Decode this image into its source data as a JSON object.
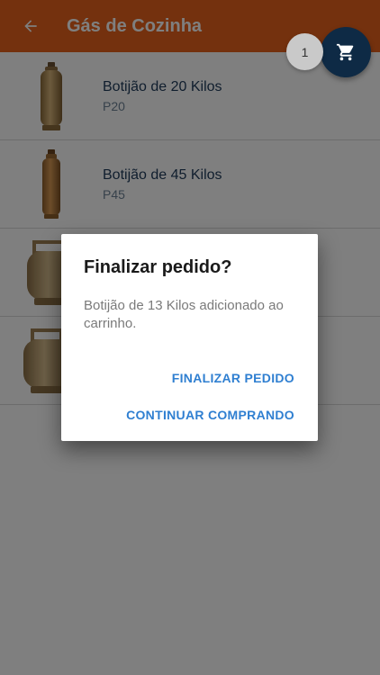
{
  "appbar": {
    "title": "Gás de Cozinha",
    "color": "#e8621c"
  },
  "cart": {
    "count": "1"
  },
  "products": [
    {
      "name": "Botijão de 20 Kilos",
      "code": "P20",
      "icon": "tall-gas-cylinder-icon"
    },
    {
      "name": "Botijão de 45 Kilos",
      "code": "P45",
      "icon": "large-gas-cylinder-icon"
    },
    {
      "name": "",
      "code": "",
      "icon": "gas-cylinder-icon"
    },
    {
      "name": "",
      "code": "",
      "icon": "gas-cylinder-icon"
    }
  ],
  "dialog": {
    "title": "Finalizar pedido?",
    "message": "Botijão de 13 Kilos adicionado ao carrinho.",
    "primary_label": "FINALIZAR PEDIDO",
    "secondary_label": "CONTINUAR COMPRANDO"
  }
}
